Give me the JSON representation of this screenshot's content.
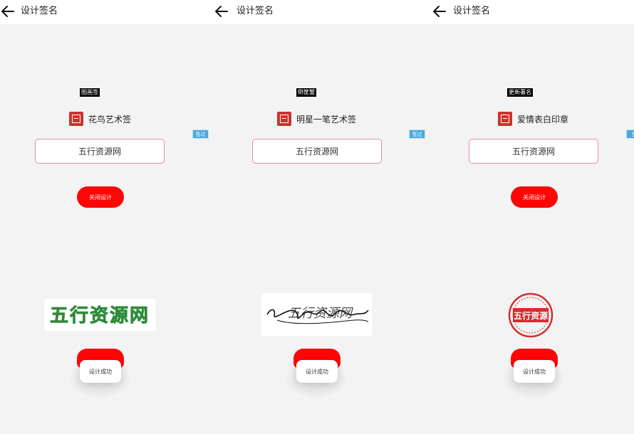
{
  "screens": [
    {
      "title": "设计签名",
      "tag": "图画签",
      "seal_label": "花鸟艺术签",
      "input_value": "五行资源网",
      "side_badge": "签过",
      "design_button": "关闭设计",
      "preview_text": "五行资源网",
      "preview_style": "花鸟艺术签",
      "popup_text": "设计成功"
    },
    {
      "title": "设计签名",
      "tag": "倒筐蟹",
      "seal_label": "明星一笔艺术签",
      "input_value": "五行资源网",
      "side_badge": "签过",
      "design_button": "",
      "preview_text": "五行资源网",
      "preview_style": "明星一笔艺术签",
      "popup_text": "设计成功"
    },
    {
      "title": "设计签名",
      "tag": "更新署名",
      "seal_label": "爱情表白印章",
      "input_value": "五行资源网",
      "side_badge": "签",
      "design_button": "关闭设计",
      "preview_text": "五行资源",
      "preview_style": "爱情表白印章",
      "popup_text": "设计成功"
    }
  ],
  "colors": {
    "primary_red": "#ff0505",
    "input_border": "#e98a99",
    "badge_blue": "#4aa7dc",
    "background": "#f3f3f3"
  },
  "icons": [
    "back-arrow-icon",
    "seal-icon"
  ]
}
